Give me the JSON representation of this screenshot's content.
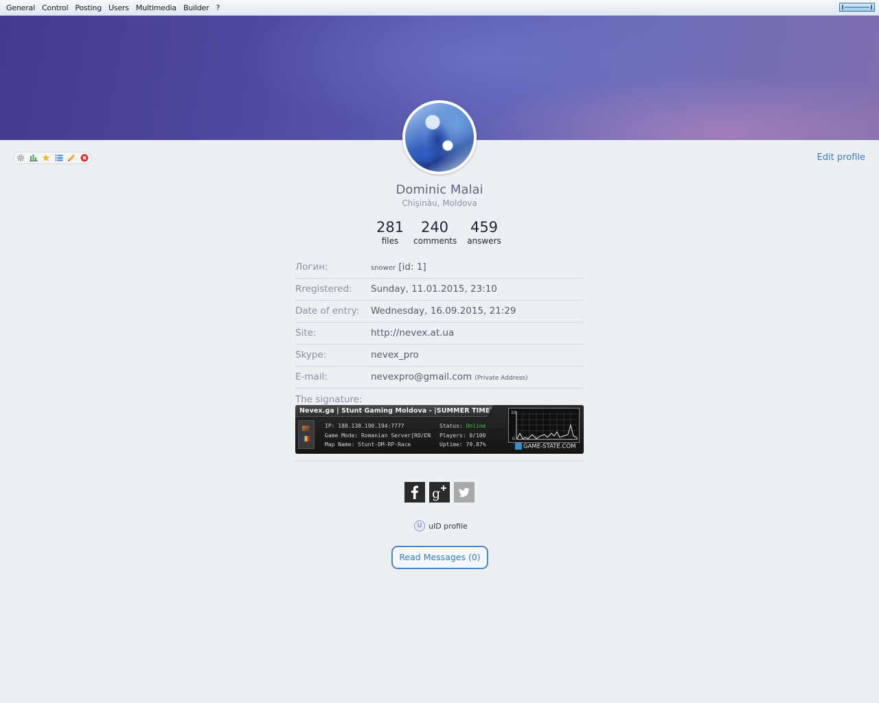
{
  "topbar": {
    "menu": [
      "General",
      "Control",
      "Posting",
      "Users",
      "Multimedia",
      "Builder",
      "?"
    ]
  },
  "toolbar": {
    "icons": [
      "gear-icon",
      "stats-icon",
      "star-icon",
      "list-icon",
      "pencil-icon",
      "delete-icon"
    ]
  },
  "header": {
    "edit_profile": "Edit profile"
  },
  "profile": {
    "name": "Dominic Malai",
    "location": "Chişinău, Moldova"
  },
  "stats": [
    {
      "value": "281",
      "label": "files"
    },
    {
      "value": "240",
      "label": "comments"
    },
    {
      "value": "459",
      "label": "answers"
    }
  ],
  "details": {
    "login_label": "Логин:",
    "login_value": "snower",
    "login_id": "[id: 1]",
    "registered_label": "Rregistered:",
    "registered_value": "Sunday, 11.01.2015, 23:10",
    "entry_label": "Date of entry:",
    "entry_value": "Wednesday, 16.09.2015, 21:29",
    "site_label": "Site:",
    "site_value": "http://nevex.at.ua",
    "skype_label": "Skype:",
    "skype_value": "nevex_pro",
    "email_label": "E-mail:",
    "email_value": "nevexpro@gmail.com",
    "email_note": "(Private Address)",
    "signature_label": "The signature:"
  },
  "signature_banner": {
    "title": "Nevex.ga | Stunt Gaming Moldova - |SUMMER TIME|",
    "ip": "IP: 188.138.190.194:7777",
    "game_mode": "Game Mode: Romanian Server[RO/EN",
    "map_name": "Map Name: Stunt-DM-RP-Race",
    "status_label": "Status: ",
    "status_value": "Online",
    "players": "Players: 0/100",
    "uptime": "Uptime: 79.87%",
    "graph_max": "10",
    "graph_min": "0",
    "brand": "GAME-STATE.COM"
  },
  "social": {
    "icons": [
      "facebook-icon",
      "google-plus-icon",
      "twitter-icon"
    ],
    "colors": {
      "facebook": "#2b2b2b",
      "google_plus": "#2b2b2b",
      "twitter": "#a9a9a9"
    }
  },
  "uid": {
    "label": "uID profile"
  },
  "messages": {
    "button": "Read Messages (0)"
  },
  "colors": {
    "accent": "#3b7ab8",
    "page_bg": "#eceff4"
  }
}
